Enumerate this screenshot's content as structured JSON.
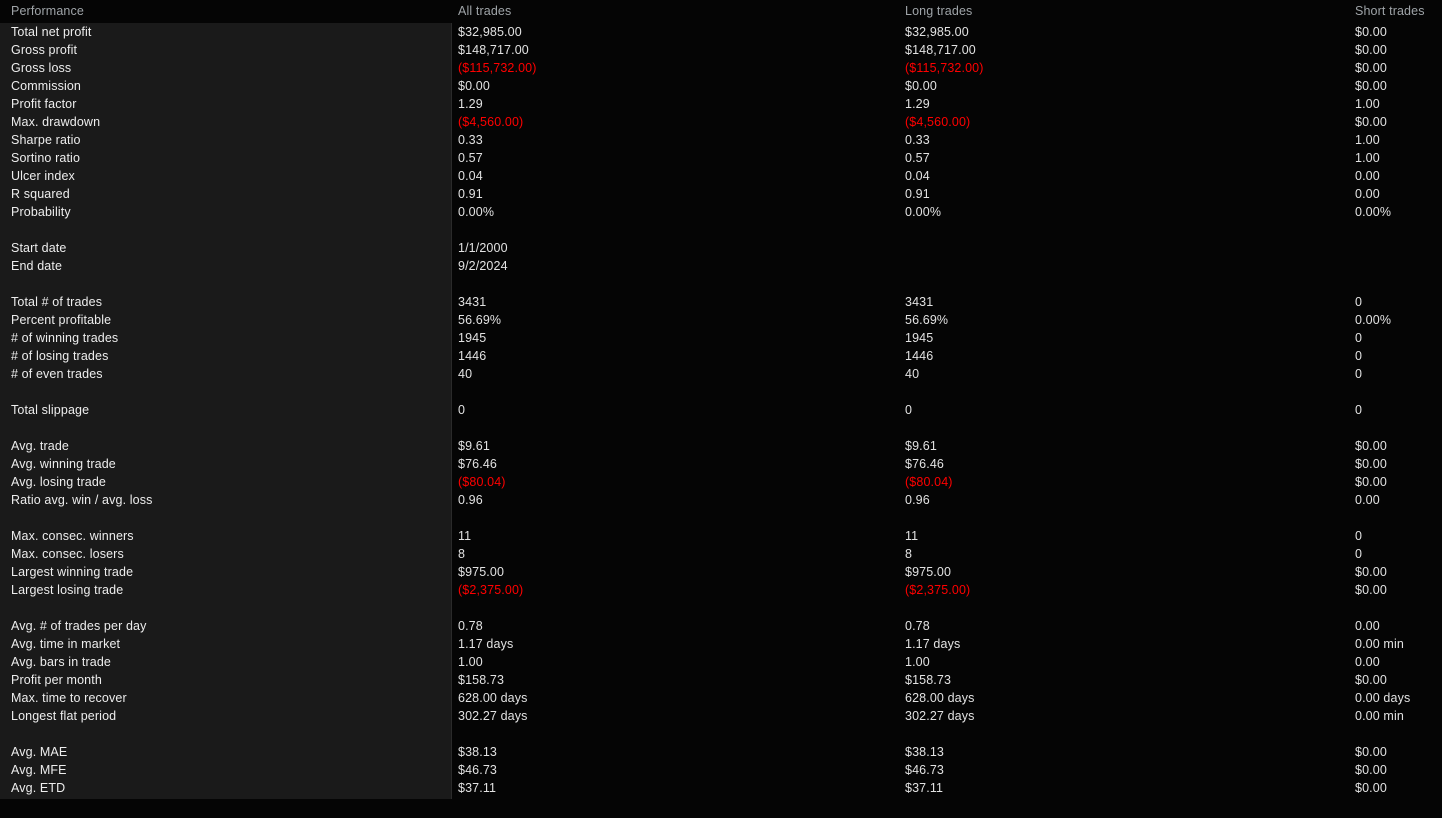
{
  "columns": {
    "label": "Performance",
    "all": "All trades",
    "long": "Long trades",
    "short": "Short trades"
  },
  "rows": [
    {
      "label": "Total net profit",
      "all": "$32,985.00",
      "long": "$32,985.00",
      "short": "$0.00",
      "neg": false
    },
    {
      "label": "Gross profit",
      "all": "$148,717.00",
      "long": "$148,717.00",
      "short": "$0.00",
      "neg": false
    },
    {
      "label": "Gross loss",
      "all": "($115,732.00)",
      "long": "($115,732.00)",
      "short": "$0.00",
      "neg": true,
      "neg_cols": [
        "all",
        "long"
      ]
    },
    {
      "label": "Commission",
      "all": "$0.00",
      "long": "$0.00",
      "short": "$0.00",
      "neg": false
    },
    {
      "label": "Profit factor",
      "all": "1.29",
      "long": "1.29",
      "short": "1.00",
      "neg": false
    },
    {
      "label": "Max. drawdown",
      "all": "($4,560.00)",
      "long": "($4,560.00)",
      "short": "$0.00",
      "neg": true,
      "neg_cols": [
        "all",
        "long"
      ]
    },
    {
      "label": "Sharpe ratio",
      "all": "0.33",
      "long": "0.33",
      "short": "1.00",
      "neg": false
    },
    {
      "label": "Sortino ratio",
      "all": "0.57",
      "long": "0.57",
      "short": "1.00",
      "neg": false
    },
    {
      "label": "Ulcer index",
      "all": "0.04",
      "long": "0.04",
      "short": "0.00",
      "neg": false
    },
    {
      "label": "R squared",
      "all": "0.91",
      "long": "0.91",
      "short": "0.00",
      "neg": false
    },
    {
      "label": "Probability",
      "all": "0.00%",
      "long": "0.00%",
      "short": "0.00%",
      "neg": false
    },
    {
      "spacer": true
    },
    {
      "label": "Start date",
      "all": "1/1/2000",
      "long": "",
      "short": "",
      "neg": false
    },
    {
      "label": "End date",
      "all": "9/2/2024",
      "long": "",
      "short": "",
      "neg": false
    },
    {
      "spacer": true
    },
    {
      "label": "Total # of trades",
      "all": "3431",
      "long": "3431",
      "short": "0",
      "neg": false
    },
    {
      "label": "Percent profitable",
      "all": "56.69%",
      "long": "56.69%",
      "short": "0.00%",
      "neg": false
    },
    {
      "label": "# of winning trades",
      "all": "1945",
      "long": "1945",
      "short": "0",
      "neg": false
    },
    {
      "label": "# of losing trades",
      "all": "1446",
      "long": "1446",
      "short": "0",
      "neg": false
    },
    {
      "label": "# of even trades",
      "all": "40",
      "long": "40",
      "short": "0",
      "neg": false
    },
    {
      "spacer": true
    },
    {
      "label": "Total slippage",
      "all": "0",
      "long": "0",
      "short": "0",
      "neg": false
    },
    {
      "spacer": true
    },
    {
      "label": "Avg. trade",
      "all": "$9.61",
      "long": "$9.61",
      "short": "$0.00",
      "neg": false
    },
    {
      "label": "Avg. winning trade",
      "all": "$76.46",
      "long": "$76.46",
      "short": "$0.00",
      "neg": false
    },
    {
      "label": "Avg. losing trade",
      "all": "($80.04)",
      "long": "($80.04)",
      "short": "$0.00",
      "neg": true,
      "neg_cols": [
        "all",
        "long"
      ]
    },
    {
      "label": "Ratio avg. win / avg. loss",
      "all": "0.96",
      "long": "0.96",
      "short": "0.00",
      "neg": false
    },
    {
      "spacer": true
    },
    {
      "label": "Max. consec. winners",
      "all": "11",
      "long": "11",
      "short": "0",
      "neg": false
    },
    {
      "label": "Max. consec. losers",
      "all": "8",
      "long": "8",
      "short": "0",
      "neg": false
    },
    {
      "label": "Largest winning trade",
      "all": "$975.00",
      "long": "$975.00",
      "short": "$0.00",
      "neg": false
    },
    {
      "label": "Largest losing trade",
      "all": "($2,375.00)",
      "long": "($2,375.00)",
      "short": "$0.00",
      "neg": true,
      "neg_cols": [
        "all",
        "long"
      ]
    },
    {
      "spacer": true
    },
    {
      "label": "Avg. # of trades per day",
      "all": "0.78",
      "long": "0.78",
      "short": "0.00",
      "neg": false
    },
    {
      "label": "Avg. time in market",
      "all": "1.17 days",
      "long": "1.17 days",
      "short": "0.00 min",
      "neg": false
    },
    {
      "label": "Avg. bars in trade",
      "all": "1.00",
      "long": "1.00",
      "short": "0.00",
      "neg": false
    },
    {
      "label": "Profit per month",
      "all": "$158.73",
      "long": "$158.73",
      "short": "$0.00",
      "neg": false
    },
    {
      "label": "Max. time to recover",
      "all": "628.00 days",
      "long": "628.00 days",
      "short": "0.00 days",
      "neg": false
    },
    {
      "label": "Longest flat period",
      "all": "302.27 days",
      "long": "302.27 days",
      "short": "0.00 min",
      "neg": false
    },
    {
      "spacer": true
    },
    {
      "label": "Avg. MAE",
      "all": "$38.13",
      "long": "$38.13",
      "short": "$0.00",
      "neg": false
    },
    {
      "label": "Avg. MFE",
      "all": "$46.73",
      "long": "$46.73",
      "short": "$0.00",
      "neg": false
    },
    {
      "label": "Avg. ETD",
      "all": "$37.11",
      "long": "$37.11",
      "short": "$0.00",
      "neg": false
    }
  ],
  "colors": {
    "negative": "#ff0000",
    "positive": "#e2e2e2",
    "header_text": "#9fa4a8",
    "panel_bg": "#1a1a1a",
    "main_bg": "#050505"
  }
}
